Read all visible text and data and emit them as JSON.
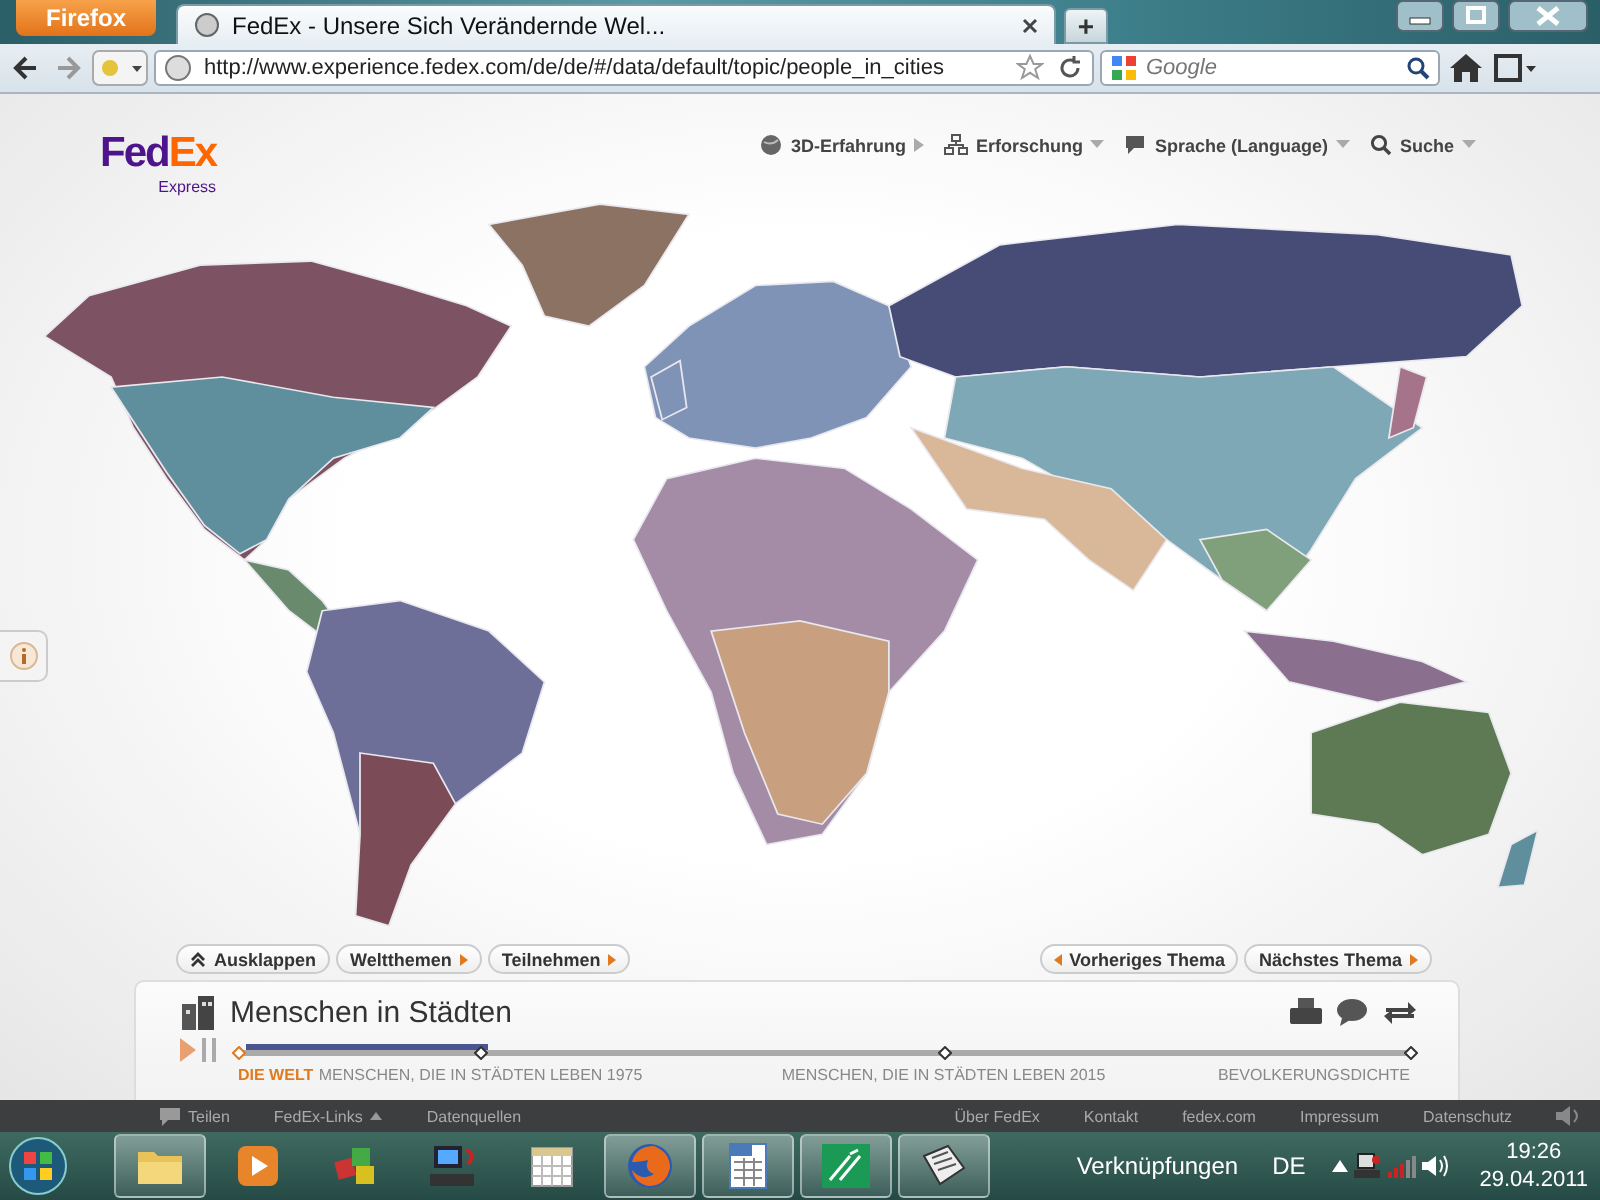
{
  "browser": {
    "app_button": "Firefox",
    "tab_title": "FedEx - Unsere Sich Verändernde Wel...",
    "new_tab": "+",
    "url": "http://www.experience.fedex.com/de/de/#/data/default/topic/people_in_cities",
    "search_placeholder": "Google"
  },
  "site": {
    "logo": {
      "left": "Fed",
      "right": "Ex",
      "sub": "Express"
    },
    "nav": [
      {
        "label": "3D-Erfahrung",
        "kind": "globe"
      },
      {
        "label": "Erforschung",
        "kind": "tree"
      },
      {
        "label": "Sprache (Language)",
        "kind": "speech"
      },
      {
        "label": "Suche",
        "kind": "search"
      }
    ],
    "buttons_left": [
      {
        "label": "Ausklappen",
        "kind": "expand"
      },
      {
        "label": "Weltthemen",
        "kind": "next"
      },
      {
        "label": "Teilnehmen",
        "kind": "next"
      }
    ],
    "buttons_right": [
      {
        "label": "Vorheriges Thema",
        "kind": "prev"
      },
      {
        "label": "Nächstes Thema",
        "kind": "next"
      }
    ],
    "panel": {
      "title": "Menschen in Städten",
      "timeline": {
        "level": 0.21,
        "stops": [
          {
            "label": "DIE WELT",
            "selected": true
          },
          {
            "label": "MENSCHEN, DIE IN STÄDTEN LEBEN 1975",
            "selected": false
          },
          {
            "label": "MENSCHEN, DIE IN STÄDTEN LEBEN 2015",
            "selected": false
          },
          {
            "label": "BEVOLKERUNGSDICHTE",
            "selected": false
          }
        ]
      }
    }
  },
  "footer": {
    "left": [
      "Teilen",
      "FedEx-Links",
      "Datenquellen"
    ],
    "right": [
      "Über FedEx",
      "Kontakt",
      "fedex.com",
      "Impressum",
      "Datenschutz"
    ]
  },
  "taskbar": {
    "apps": [
      {
        "kind": "folder",
        "running": true
      },
      {
        "kind": "media",
        "running": false
      },
      {
        "kind": "paint",
        "running": false
      },
      {
        "kind": "computer",
        "running": false
      },
      {
        "kind": "calendar",
        "running": false
      },
      {
        "kind": "firefox",
        "running": true
      },
      {
        "kind": "spreadsheet",
        "running": true
      },
      {
        "kind": "bank",
        "running": true
      },
      {
        "kind": "newspaper",
        "running": true
      }
    ],
    "toolbar_label": "Verknüpfungen",
    "language": "DE",
    "time": "19:26",
    "date": "29.04.2011"
  }
}
